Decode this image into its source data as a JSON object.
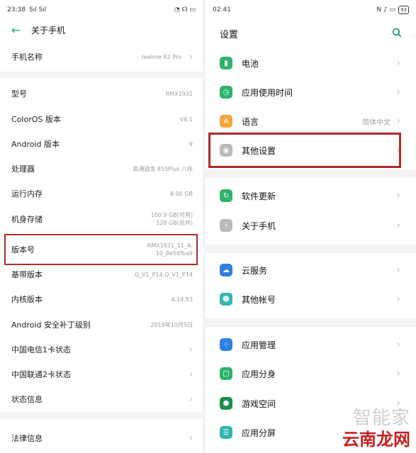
{
  "left": {
    "status": {
      "time": "23:38",
      "signal": "Sıl Sıl",
      "right_icons": "◔ ☊ ▭"
    },
    "header": {
      "back_icon": "arrow-left-icon",
      "title": "关于手机"
    },
    "rows": [
      {
        "label": "手机名称",
        "value": "realme X2 Pro",
        "chevron": true
      },
      {
        "label": "型号",
        "value": "RMX1931",
        "chevron": false
      },
      {
        "label": "ColorOS 版本",
        "value": "V6.1",
        "chevron": false
      },
      {
        "label": "Android 版本",
        "value": "9",
        "chevron": false
      },
      {
        "label": "处理器",
        "value": "高通骁龙 855Plus 八核",
        "chevron": false
      },
      {
        "label": "运行内存",
        "value": "8.00 GB",
        "chevron": false
      },
      {
        "label": "机身存储",
        "value": "100.9 GB(可用)\n128 GB(总共)",
        "chevron": false
      },
      {
        "label": "版本号",
        "value": "RMX1931_11_A.\n10_8e56fba9",
        "chevron": false
      },
      {
        "label": "基带版本",
        "value": "Q_V1_P14,Q_V1_P14",
        "chevron": false
      },
      {
        "label": "内核版本",
        "value": "4.14.83",
        "chevron": false
      },
      {
        "label": "Android 安全补丁级别",
        "value": "2019年10月5日",
        "chevron": false
      },
      {
        "label": "中国电信1卡状态",
        "value": "",
        "chevron": true
      },
      {
        "label": "中国联通2卡状态",
        "value": "",
        "chevron": true
      },
      {
        "label": "状态信息",
        "value": "",
        "chevron": true
      },
      {
        "label": "法律信息",
        "value": "",
        "chevron": true
      }
    ]
  },
  "right": {
    "status": {
      "time": "02:41",
      "right_icons": "N  ♪ ▭",
      "battery": "93"
    },
    "header": {
      "title": "设置",
      "search_icon": "search-icon"
    },
    "rows": [
      {
        "label": "电池",
        "value": "",
        "icon": "battery-icon",
        "icon_color": "#2db36a",
        "glyph": "▮"
      },
      {
        "label": "应用使用时间",
        "value": "",
        "icon": "app-usage-icon",
        "icon_color": "#2db36a",
        "glyph": "◷"
      },
      {
        "label": "语言",
        "value": "简体中文",
        "icon": "language-icon",
        "icon_color": "#f0a63a",
        "glyph": "A"
      },
      {
        "label": "其他设置",
        "value": "",
        "icon": "other-settings-icon",
        "icon_color": "#b9b9b9",
        "glyph": "◉"
      },
      {
        "label": "软件更新",
        "value": "",
        "icon": "software-update-icon",
        "icon_color": "#2db36a",
        "glyph": "↻"
      },
      {
        "label": "关于手机",
        "value": "",
        "icon": "about-phone-icon",
        "icon_color": "#b9b9b9",
        "glyph": "i"
      },
      {
        "label": "云服务",
        "value": "",
        "icon": "cloud-icon",
        "icon_color": "#2f7fe0",
        "glyph": "☁"
      },
      {
        "label": "其他帐号",
        "value": "",
        "icon": "account-icon",
        "icon_color": "#2fb7b0",
        "glyph": "☻"
      },
      {
        "label": "应用管理",
        "value": "",
        "icon": "app-management-icon",
        "icon_color": "#2f7fe0",
        "glyph": "⁘"
      },
      {
        "label": "应用分身",
        "value": "",
        "icon": "app-clone-icon",
        "icon_color": "#2db36a",
        "glyph": "▢"
      },
      {
        "label": "游戏空间",
        "value": "",
        "icon": "game-space-icon",
        "icon_color": "#1a8f4a",
        "glyph": "⬢"
      },
      {
        "label": "应用分屏",
        "value": "",
        "icon": "split-screen-icon",
        "icon_color": "#2fb7b0",
        "glyph": "☰"
      }
    ]
  },
  "watermark": {
    "line1": "智能家",
    "line2": "云南龙网"
  },
  "colors": {
    "accent": "#1aa36b",
    "highlight": "#b02a2a"
  }
}
